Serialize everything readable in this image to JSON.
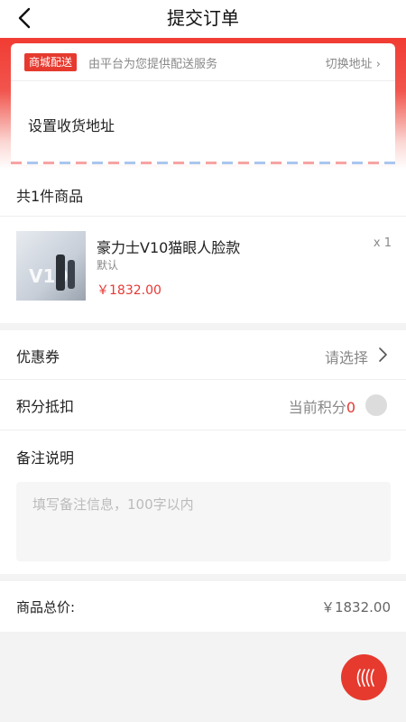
{
  "header": {
    "title": "提交订单"
  },
  "address": {
    "tag": "商城配送",
    "description": "由平台为您提供配送服务",
    "switch_label": "切换地址",
    "set_label": "设置收货地址"
  },
  "goods": {
    "count_label": "共1件商品",
    "items": [
      {
        "name": "豪力士V10猫眼人脸款",
        "spec": "默认",
        "price": "￥1832.00",
        "quantity": "x 1"
      }
    ]
  },
  "coupon": {
    "label": "优惠券",
    "value": "请选择"
  },
  "points": {
    "label": "积分抵扣",
    "current_label": "当前积分",
    "current_value": "0"
  },
  "remark": {
    "label": "备注说明",
    "placeholder": "填写备注信息，100字以内"
  },
  "total": {
    "label": "商品总价:",
    "value": "￥1832.00"
  },
  "colors": {
    "accent": "#e63a2f",
    "price": "#e53935"
  },
  "icons": {
    "back": "chevron-left-icon",
    "coupon_arrow": "chevron-right-icon",
    "fab": "wave-lines-icon"
  }
}
